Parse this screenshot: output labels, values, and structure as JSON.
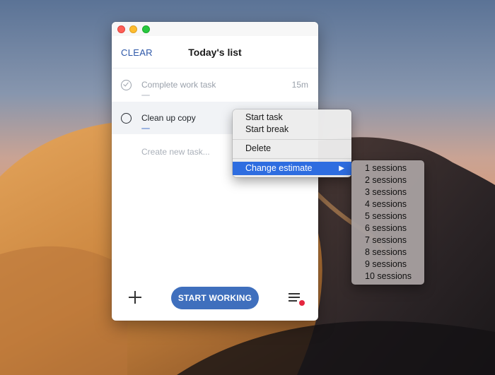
{
  "window": {
    "clear_label": "CLEAR",
    "title": "Today's list",
    "tasks": [
      {
        "label": "Complete work task",
        "estimate": "15m",
        "done": true
      },
      {
        "label": "Clean up copy",
        "estimate": "",
        "done": false
      }
    ],
    "new_task_placeholder": "Create new task...",
    "start_button": "START WORKING",
    "icons": {
      "add": "plus-icon",
      "menu": "hamburger-menu-icon",
      "notification": "red-dot-badge"
    }
  },
  "context_menu": {
    "items": [
      "Start task",
      "Start break",
      "Delete",
      "Change estimate"
    ],
    "highlighted": "Change estimate",
    "submenu_arrow": "▶"
  },
  "submenu": {
    "items": [
      "1 sessions",
      "2 sessions",
      "3 sessions",
      "4 sessions",
      "5 sessions",
      "6 sessions",
      "7 sessions",
      "8 sessions",
      "9 sessions",
      "10 sessions"
    ]
  },
  "colors": {
    "accent": "#3f6fbd",
    "highlight": "#2e6de0",
    "badge": "#e5263f"
  }
}
